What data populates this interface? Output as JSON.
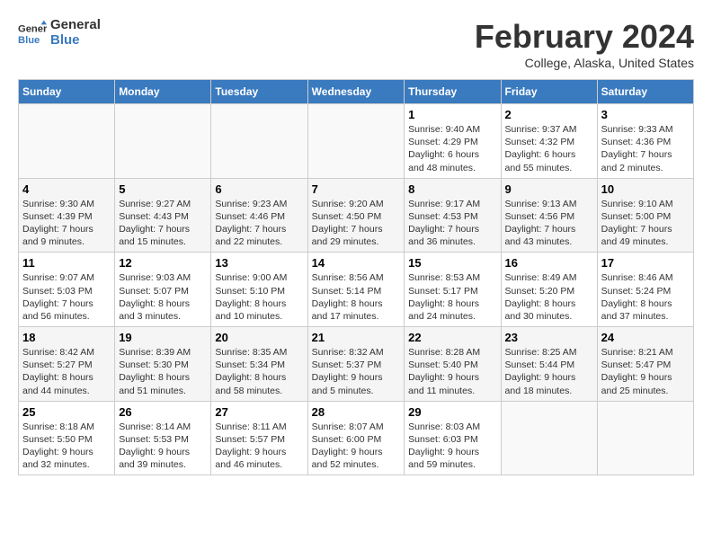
{
  "header": {
    "logo_line1": "General",
    "logo_line2": "Blue",
    "title": "February 2024",
    "subtitle": "College, Alaska, United States"
  },
  "columns": [
    "Sunday",
    "Monday",
    "Tuesday",
    "Wednesday",
    "Thursday",
    "Friday",
    "Saturday"
  ],
  "weeks": [
    [
      {
        "day": "",
        "info": ""
      },
      {
        "day": "",
        "info": ""
      },
      {
        "day": "",
        "info": ""
      },
      {
        "day": "",
        "info": ""
      },
      {
        "day": "1",
        "info": "Sunrise: 9:40 AM\nSunset: 4:29 PM\nDaylight: 6 hours\nand 48 minutes."
      },
      {
        "day": "2",
        "info": "Sunrise: 9:37 AM\nSunset: 4:32 PM\nDaylight: 6 hours\nand 55 minutes."
      },
      {
        "day": "3",
        "info": "Sunrise: 9:33 AM\nSunset: 4:36 PM\nDaylight: 7 hours\nand 2 minutes."
      }
    ],
    [
      {
        "day": "4",
        "info": "Sunrise: 9:30 AM\nSunset: 4:39 PM\nDaylight: 7 hours\nand 9 minutes."
      },
      {
        "day": "5",
        "info": "Sunrise: 9:27 AM\nSunset: 4:43 PM\nDaylight: 7 hours\nand 15 minutes."
      },
      {
        "day": "6",
        "info": "Sunrise: 9:23 AM\nSunset: 4:46 PM\nDaylight: 7 hours\nand 22 minutes."
      },
      {
        "day": "7",
        "info": "Sunrise: 9:20 AM\nSunset: 4:50 PM\nDaylight: 7 hours\nand 29 minutes."
      },
      {
        "day": "8",
        "info": "Sunrise: 9:17 AM\nSunset: 4:53 PM\nDaylight: 7 hours\nand 36 minutes."
      },
      {
        "day": "9",
        "info": "Sunrise: 9:13 AM\nSunset: 4:56 PM\nDaylight: 7 hours\nand 43 minutes."
      },
      {
        "day": "10",
        "info": "Sunrise: 9:10 AM\nSunset: 5:00 PM\nDaylight: 7 hours\nand 49 minutes."
      }
    ],
    [
      {
        "day": "11",
        "info": "Sunrise: 9:07 AM\nSunset: 5:03 PM\nDaylight: 7 hours\nand 56 minutes."
      },
      {
        "day": "12",
        "info": "Sunrise: 9:03 AM\nSunset: 5:07 PM\nDaylight: 8 hours\nand 3 minutes."
      },
      {
        "day": "13",
        "info": "Sunrise: 9:00 AM\nSunset: 5:10 PM\nDaylight: 8 hours\nand 10 minutes."
      },
      {
        "day": "14",
        "info": "Sunrise: 8:56 AM\nSunset: 5:14 PM\nDaylight: 8 hours\nand 17 minutes."
      },
      {
        "day": "15",
        "info": "Sunrise: 8:53 AM\nSunset: 5:17 PM\nDaylight: 8 hours\nand 24 minutes."
      },
      {
        "day": "16",
        "info": "Sunrise: 8:49 AM\nSunset: 5:20 PM\nDaylight: 8 hours\nand 30 minutes."
      },
      {
        "day": "17",
        "info": "Sunrise: 8:46 AM\nSunset: 5:24 PM\nDaylight: 8 hours\nand 37 minutes."
      }
    ],
    [
      {
        "day": "18",
        "info": "Sunrise: 8:42 AM\nSunset: 5:27 PM\nDaylight: 8 hours\nand 44 minutes."
      },
      {
        "day": "19",
        "info": "Sunrise: 8:39 AM\nSunset: 5:30 PM\nDaylight: 8 hours\nand 51 minutes."
      },
      {
        "day": "20",
        "info": "Sunrise: 8:35 AM\nSunset: 5:34 PM\nDaylight: 8 hours\nand 58 minutes."
      },
      {
        "day": "21",
        "info": "Sunrise: 8:32 AM\nSunset: 5:37 PM\nDaylight: 9 hours\nand 5 minutes."
      },
      {
        "day": "22",
        "info": "Sunrise: 8:28 AM\nSunset: 5:40 PM\nDaylight: 9 hours\nand 11 minutes."
      },
      {
        "day": "23",
        "info": "Sunrise: 8:25 AM\nSunset: 5:44 PM\nDaylight: 9 hours\nand 18 minutes."
      },
      {
        "day": "24",
        "info": "Sunrise: 8:21 AM\nSunset: 5:47 PM\nDaylight: 9 hours\nand 25 minutes."
      }
    ],
    [
      {
        "day": "25",
        "info": "Sunrise: 8:18 AM\nSunset: 5:50 PM\nDaylight: 9 hours\nand 32 minutes."
      },
      {
        "day": "26",
        "info": "Sunrise: 8:14 AM\nSunset: 5:53 PM\nDaylight: 9 hours\nand 39 minutes."
      },
      {
        "day": "27",
        "info": "Sunrise: 8:11 AM\nSunset: 5:57 PM\nDaylight: 9 hours\nand 46 minutes."
      },
      {
        "day": "28",
        "info": "Sunrise: 8:07 AM\nSunset: 6:00 PM\nDaylight: 9 hours\nand 52 minutes."
      },
      {
        "day": "29",
        "info": "Sunrise: 8:03 AM\nSunset: 6:03 PM\nDaylight: 9 hours\nand 59 minutes."
      },
      {
        "day": "",
        "info": ""
      },
      {
        "day": "",
        "info": ""
      }
    ]
  ]
}
